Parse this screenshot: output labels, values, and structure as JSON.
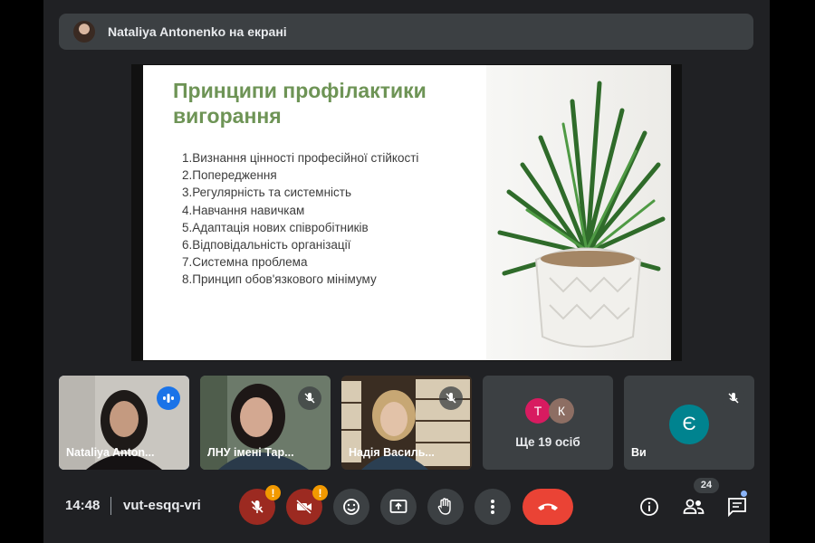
{
  "banner": {
    "text": "Nataliya Antonenko на екрані"
  },
  "slide": {
    "title": "Принципи профілактики вигорання",
    "items": [
      "1.Визнання цінності професійної стійкості",
      "2.Попередження",
      "3.Регулярність та системність",
      "4.Навчання навичкам",
      "5.Адаптація нових співробітників",
      "6.Відповідальність організації",
      "7.Системна проблема",
      "8.Принцип обов'язкового мінімуму"
    ]
  },
  "participants": {
    "tile1": {
      "name": "Nataliya Antonenko",
      "name_shown": "Nataliya Anton..."
    },
    "tile2": {
      "name_shown": "ЛНУ імені Тар..."
    },
    "tile3": {
      "name_shown": "Надія Василь..."
    },
    "more": {
      "label": "Ще 19 осіб",
      "avatars": [
        {
          "letter": "Т",
          "color": "#d81b60"
        },
        {
          "letter": "К",
          "color": "#8d6e63"
        }
      ]
    },
    "self": {
      "label": "Ви",
      "letter": "Є",
      "color": "#00838f"
    }
  },
  "bottom": {
    "time": "14:48",
    "meeting_code": "vut-esqq-vri",
    "warn_mark": "!",
    "participant_count": "24"
  },
  "colors": {
    "accent": "#8ab4f8",
    "end_call": "#ea4335",
    "mic_off": "#9c2a21",
    "slide_title": "#6e9456",
    "warning": "#f29900"
  }
}
